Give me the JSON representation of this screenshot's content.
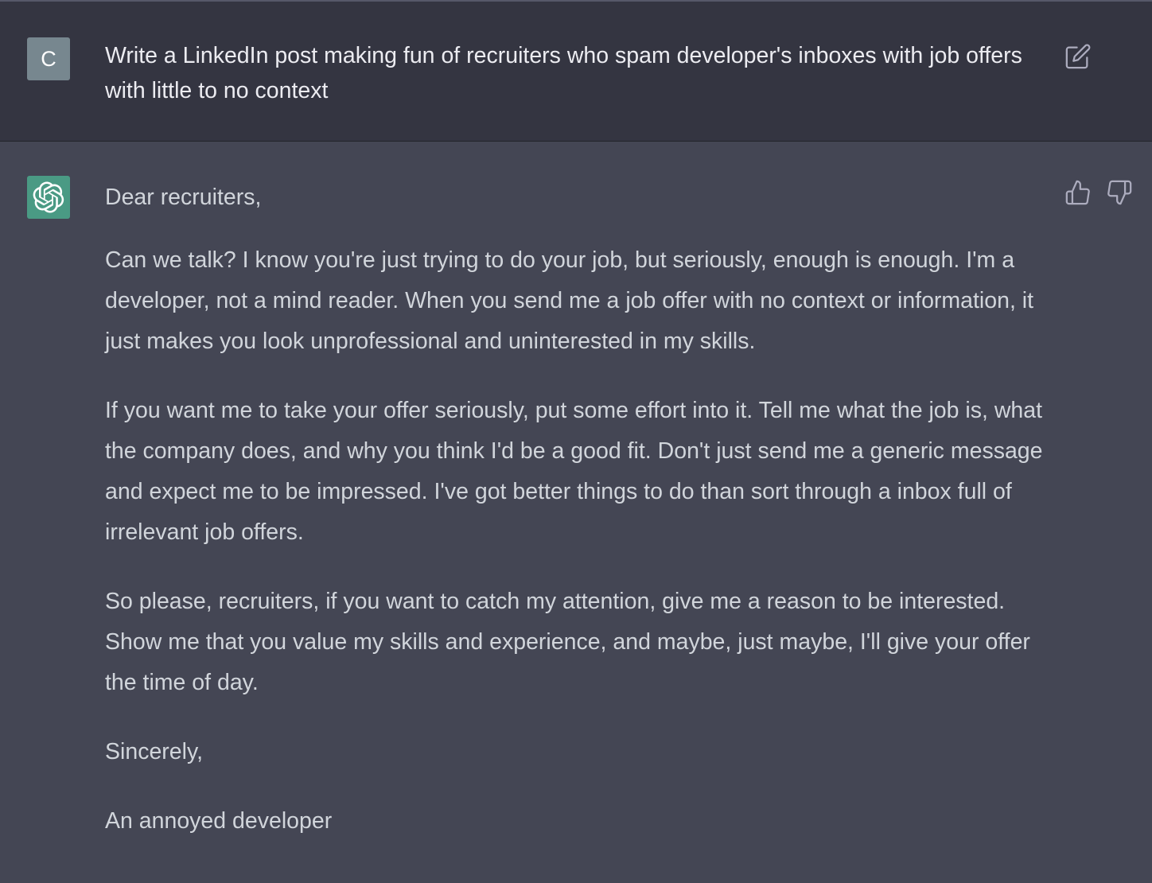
{
  "user_message": {
    "avatar_letter": "C",
    "text": "Write a LinkedIn post making fun of recruiters who spam developer's inboxes with job offers with little to no context"
  },
  "assistant_message": {
    "paragraphs": [
      "Dear recruiters,",
      "Can we talk? I know you're just trying to do your job, but seriously, enough is enough. I'm a developer, not a mind reader. When you send me a job offer with no context or information, it just makes you look unprofessional and uninterested in my skills.",
      "If you want me to take your offer seriously, put some effort into it. Tell me what the job is, what the company does, and why you think I'd be a good fit. Don't just send me a generic message and expect me to be impressed. I've got better things to do than sort through a inbox full of irrelevant job offers.",
      "So please, recruiters, if you want to catch my attention, give me a reason to be interested. Show me that you value my skills and experience, and maybe, just maybe, I'll give your offer the time of day.",
      "Sincerely,",
      "An annoyed developer"
    ]
  },
  "icons": {
    "edit": "edit-icon",
    "thumbs_up": "thumbs-up-icon",
    "thumbs_down": "thumbs-down-icon",
    "assistant_logo": "openai-logo-icon"
  },
  "colors": {
    "user_bg": "#343541",
    "assistant_bg": "#444654",
    "user_avatar": "#77878f",
    "assistant_avatar": "#4a9a84",
    "text": "#d1d5db"
  }
}
